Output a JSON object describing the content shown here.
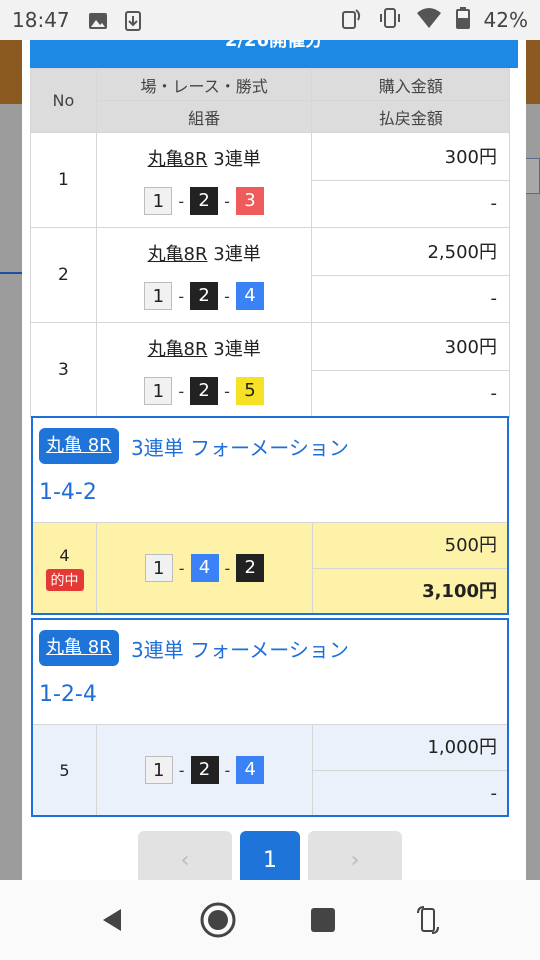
{
  "status": {
    "time": "18:47",
    "battery": "42%"
  },
  "modal": {
    "title": "2/26開催分"
  },
  "table": {
    "headers": {
      "no": "No",
      "race": "場・レース・勝式",
      "combo": "組番",
      "purchase": "購入金額",
      "payout": "払戻金額"
    },
    "rows": [
      {
        "no": "1",
        "venue": "丸亀8R",
        "type": "3連単",
        "combo": [
          "1",
          "2",
          "3"
        ],
        "purchase": "300円",
        "payout": "-"
      },
      {
        "no": "2",
        "venue": "丸亀8R",
        "type": "3連単",
        "combo": [
          "1",
          "2",
          "4"
        ],
        "purchase": "2,500円",
        "payout": "-"
      },
      {
        "no": "3",
        "venue": "丸亀8R",
        "type": "3連単",
        "combo": [
          "1",
          "2",
          "5"
        ],
        "purchase": "300円",
        "payout": "-"
      }
    ],
    "dash": "-"
  },
  "cards": [
    {
      "tag": "丸亀 8R",
      "formation": "3連単 フォーメーション",
      "combo_text": "1-4-2",
      "no": "4",
      "hit": "的中",
      "combo": [
        "1",
        "4",
        "2"
      ],
      "purchase": "500円",
      "payout": "3,100円"
    },
    {
      "tag": "丸亀 8R",
      "formation": "3連単 フォーメーション",
      "combo_text": "1-2-4",
      "no": "5",
      "combo": [
        "1",
        "2",
        "4"
      ],
      "purchase": "1,000円",
      "payout": "-"
    }
  ],
  "pager": {
    "prev": "‹",
    "current": "1",
    "next": "›"
  },
  "colors": {
    "accent": "#1e74d8",
    "hit": "#e53935",
    "box3": "#ef5a5a",
    "box4": "#3b82f6",
    "box5": "#f7e125"
  },
  "icons": [
    "image-icon",
    "download-icon",
    "nfc-icon",
    "vibrate-icon",
    "wifi-icon",
    "battery-icon",
    "back-icon",
    "home-icon",
    "recents-icon",
    "rotate-icon"
  ]
}
